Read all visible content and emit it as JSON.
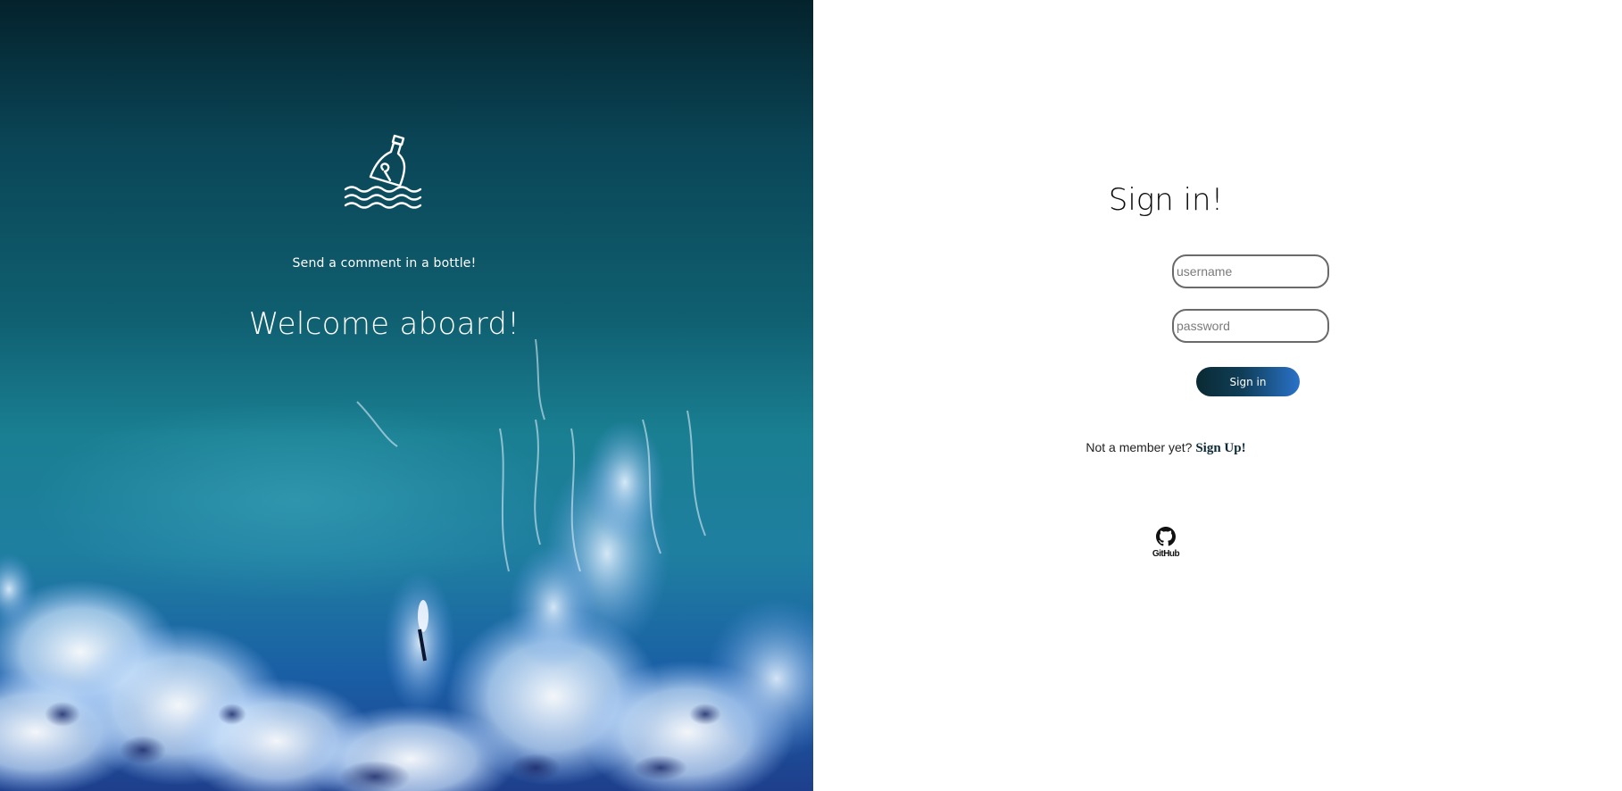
{
  "hero": {
    "tagline": "Send a comment in a bottle!",
    "welcome": "Welcome aboard!",
    "logo_icon": "message-in-a-bottle-icon"
  },
  "signin": {
    "title": "Sign in!",
    "username_placeholder": "username",
    "username_value": "",
    "password_placeholder": "password",
    "password_value": "",
    "button_label": "Sign in",
    "member_prompt": "Not a member yet?",
    "signup_label": "Sign Up!",
    "github_label": "GitHub",
    "github_icon": "github-icon"
  },
  "colors": {
    "button_gradient_start": "#0a2a33",
    "button_gradient_end": "#2a72c9",
    "hero_top": "#04222c",
    "hero_bottom": "#1e3f8c"
  }
}
